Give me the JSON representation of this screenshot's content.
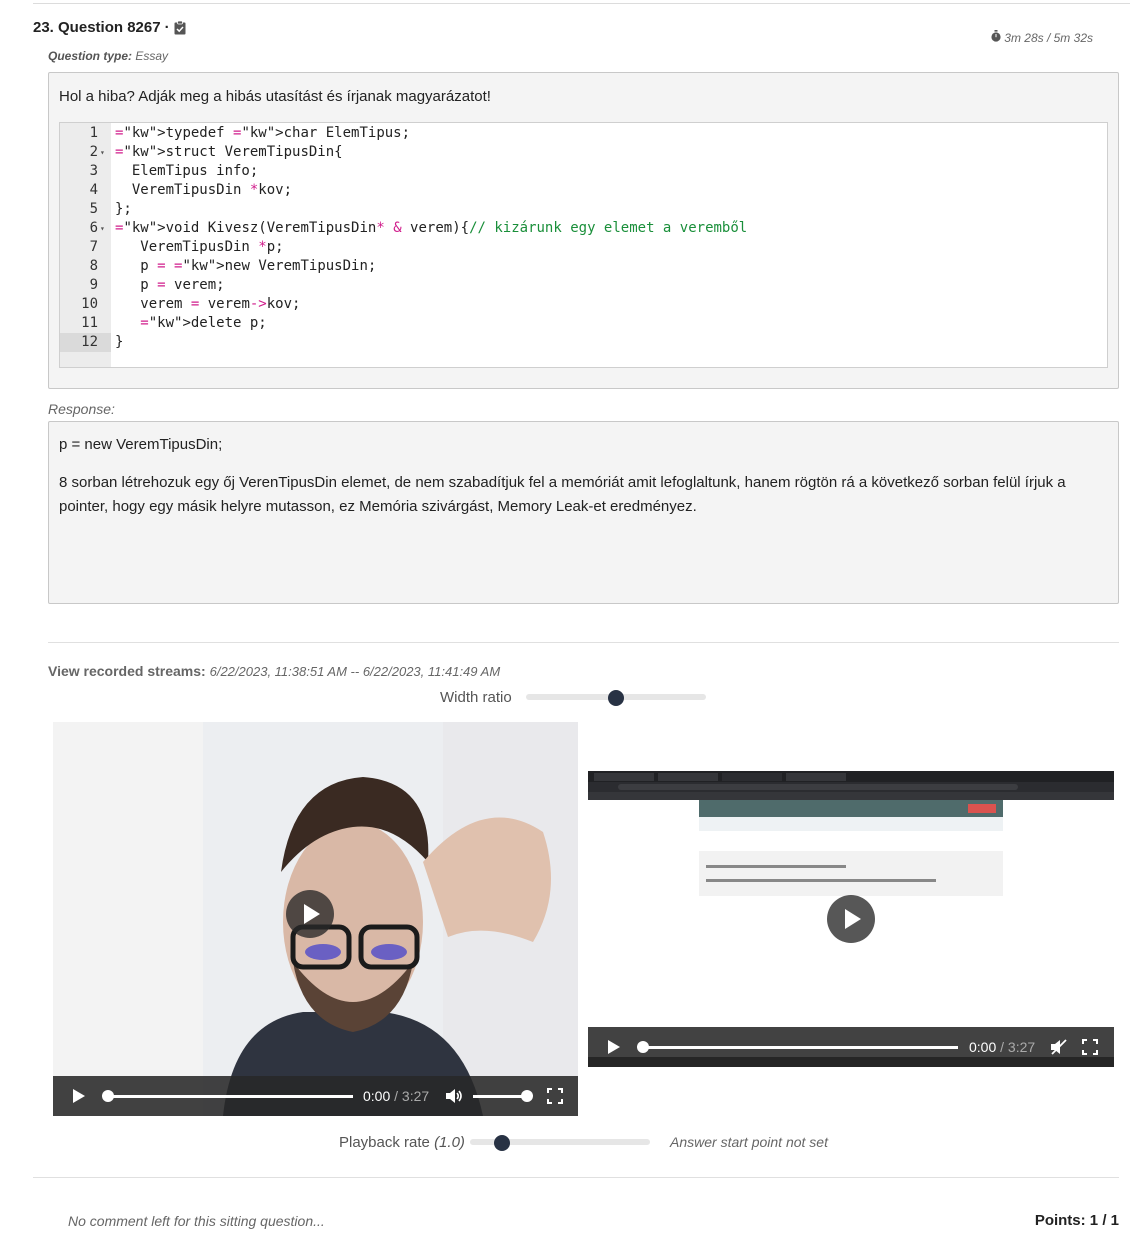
{
  "question": {
    "number_title": "23. Question 8267",
    "separator": "·",
    "timer": "3m 28s / 5m 32s",
    "type_label": "Question type:",
    "type_value": "Essay",
    "prompt": "Hol a hiba? Adják meg a hibás utasítást és írjanak magyarázatot!"
  },
  "code": {
    "active_line": 12,
    "lines": [
      {
        "n": "1",
        "fold": false
      },
      {
        "n": "2",
        "fold": true
      },
      {
        "n": "3",
        "fold": false
      },
      {
        "n": "4",
        "fold": false
      },
      {
        "n": "5",
        "fold": false
      },
      {
        "n": "6",
        "fold": true
      },
      {
        "n": "7",
        "fold": false
      },
      {
        "n": "8",
        "fold": false
      },
      {
        "n": "9",
        "fold": false
      },
      {
        "n": "10",
        "fold": false
      },
      {
        "n": "11",
        "fold": false
      },
      {
        "n": "12",
        "fold": false
      }
    ],
    "text": [
      "typedef char ElemTipus;",
      "struct VeremTipusDin{",
      "  ElemTipus info;",
      "  VeremTipusDin *kov;",
      "};",
      "void Kivesz(VeremTipusDin* & verem){// kizárunk egy elemet a veremből",
      "   VeremTipusDin *p;",
      "   p = new VeremTipusDin;",
      "   p = verem;",
      "   verem = verem->kov;",
      "   delete p;",
      "}"
    ]
  },
  "response": {
    "label": "Response:",
    "line1": "p = new VeremTipusDin;",
    "paragraph": "8 sorban létrehozuk egy őj VerenTipusDin elemet, de nem szabadítjuk fel a memóriát amit lefoglaltunk, hanem rögtön rá a következő sorban felül írjuk a pointer, hogy egy másik helyre mutasson, ez Memória szivárgást, Memory Leak-et eredményez."
  },
  "streams": {
    "label": "View recorded streams:",
    "range": "6/22/2023, 11:38:51 AM -- 6/22/2023, 11:41:49 AM",
    "width_ratio_label": "Width ratio",
    "width_ratio_value": 0.5,
    "video1": {
      "current": "0:00",
      "duration": "3:27",
      "volume": 1.0
    },
    "video2": {
      "current": "0:00",
      "duration": "3:27"
    },
    "playback_label": "Playback rate",
    "playback_value": "(1.0)",
    "playback_fraction": 0.18,
    "answer_start": "Answer start point not set"
  },
  "footer": {
    "comment": "No comment left for this sitting question...",
    "points": "Points: 1 / 1"
  },
  "icons": {
    "clipboard": "clipboard-check-icon",
    "stopwatch": "stopwatch-icon"
  }
}
